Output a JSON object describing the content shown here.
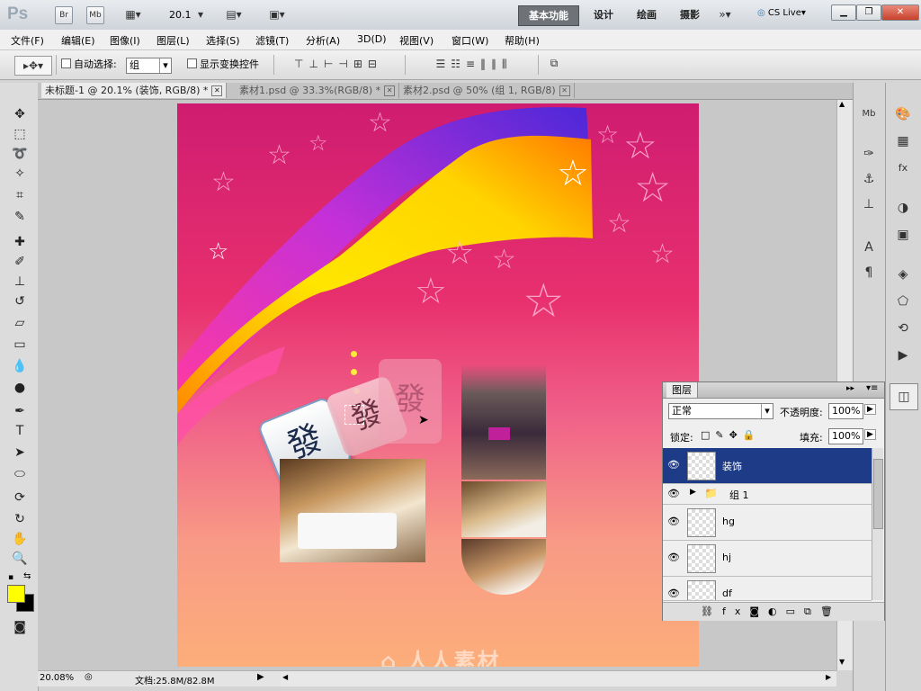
{
  "app": {
    "logo": "Ps",
    "bridge": "Br",
    "minibridge": "Mb",
    "zoom": "20.1",
    "workspaces": [
      "基本功能",
      "设计",
      "绘画",
      "摄影"
    ],
    "cslive": "CS Live"
  },
  "menu": [
    "文件(F)",
    "编辑(E)",
    "图像(I)",
    "图层(L)",
    "选择(S)",
    "滤镜(T)",
    "分析(A)",
    "3D(D)",
    "视图(V)",
    "窗口(W)",
    "帮助(H)"
  ],
  "options": {
    "auto_select_label": "自动选择:",
    "auto_select_value": "组",
    "show_transform_label": "显示变换控件"
  },
  "tabs": [
    {
      "label": "未标题-1 @ 20.1% (装饰, RGB/8) *"
    },
    {
      "label": "素材1.psd @ 33.3%(RGB/8) *"
    },
    {
      "label": "素材2.psd @ 50% (组 1, RGB/8)"
    }
  ],
  "status": {
    "zoom": "20.08%",
    "doc_size": "文档:25.8M/82.8M"
  },
  "layers_panel": {
    "title": "图层",
    "blend_mode": "正常",
    "opacity_label": "不透明度:",
    "opacity_value": "100%",
    "lock_label": "锁定:",
    "fill_label": "填充:",
    "fill_value": "100%",
    "layers": [
      {
        "name": "装饰"
      },
      {
        "name": "组 1"
      },
      {
        "name": "hg"
      },
      {
        "name": "hj"
      },
      {
        "name": "df"
      }
    ]
  },
  "canvas": {
    "tile_char": "發",
    "watermark": "人人素材"
  },
  "colors": {
    "foreground": "#ffff00",
    "background": "#000000",
    "selected_layer": "#1d3b86"
  }
}
